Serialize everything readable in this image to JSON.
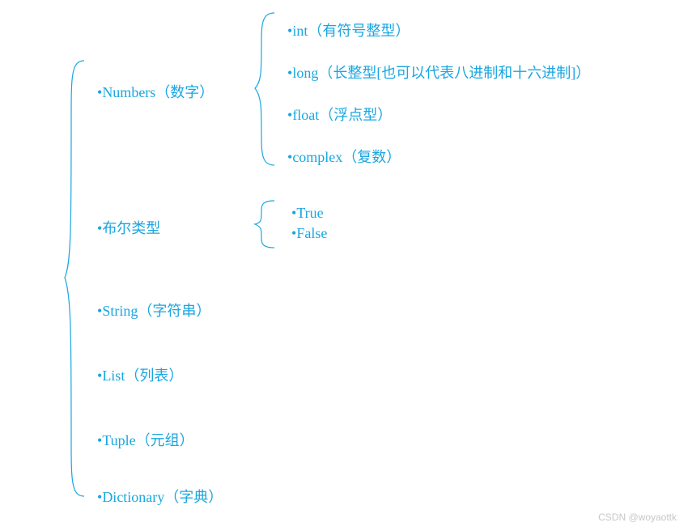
{
  "main": {
    "items": [
      "Numbers（数字）",
      "布尔类型",
      "String（字符串）",
      "List（列表）",
      "Tuple（元组）",
      "Dictionary（字典）"
    ]
  },
  "numbers": {
    "items": [
      "int（有符号整型）",
      "long（长整型[也可以代表八进制和十六进制]）",
      "float（浮点型）",
      "complex（复数）"
    ]
  },
  "boolean": {
    "items": [
      "True",
      "False"
    ]
  },
  "watermark": "CSDN @woyaottk"
}
